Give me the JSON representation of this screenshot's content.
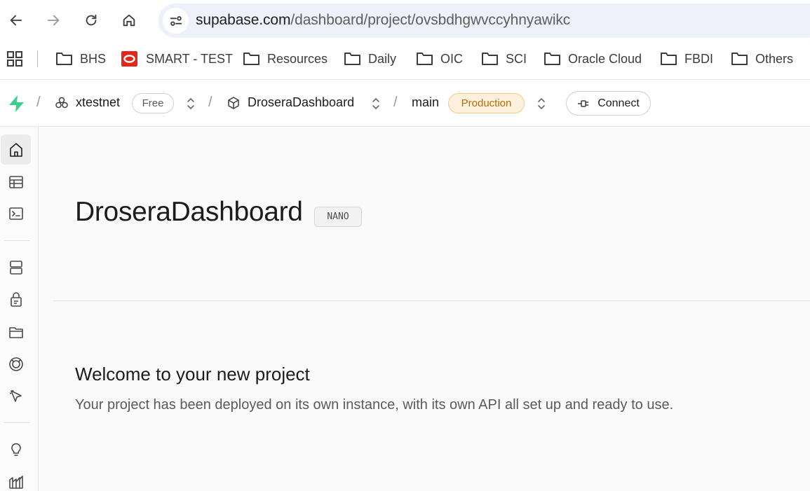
{
  "browser": {
    "url_host": "supabase.com",
    "url_path": "/dashboard/project/ovsbdhgwvccyhnyawikc",
    "bookmarks": [
      {
        "label": "BHS",
        "icon": "folder-icon"
      },
      {
        "label": "SMART - TEST",
        "icon": "oracle-icon"
      },
      {
        "label": "Resources",
        "icon": "folder-icon"
      },
      {
        "label": "Daily",
        "icon": "folder-icon"
      },
      {
        "label": "OIC",
        "icon": "folder-icon"
      },
      {
        "label": "SCI",
        "icon": "folder-icon"
      },
      {
        "label": "Oracle Cloud",
        "icon": "folder-icon"
      },
      {
        "label": "FBDI",
        "icon": "folder-icon"
      },
      {
        "label": "Others",
        "icon": "folder-icon"
      }
    ]
  },
  "header": {
    "org_name": "xtestnet",
    "org_plan": "Free",
    "project_name": "DroseraDashboard",
    "branch_name": "main",
    "branch_env": "Production",
    "connect_label": "Connect",
    "brand_color": "#3ecf8e"
  },
  "sidebar": {
    "items": [
      "home-icon",
      "table-editor-icon",
      "sql-editor-icon",
      "database-icon",
      "authentication-icon",
      "storage-icon",
      "realtime-icon",
      "edge-functions-icon",
      "advisors-icon",
      "reports-icon"
    ]
  },
  "main": {
    "project_title": "DroseraDashboard",
    "compute_badge": "NANO",
    "welcome_title": "Welcome to your new project",
    "welcome_text": "Your project has been deployed on its own instance, with its own API all set up and ready to use."
  }
}
